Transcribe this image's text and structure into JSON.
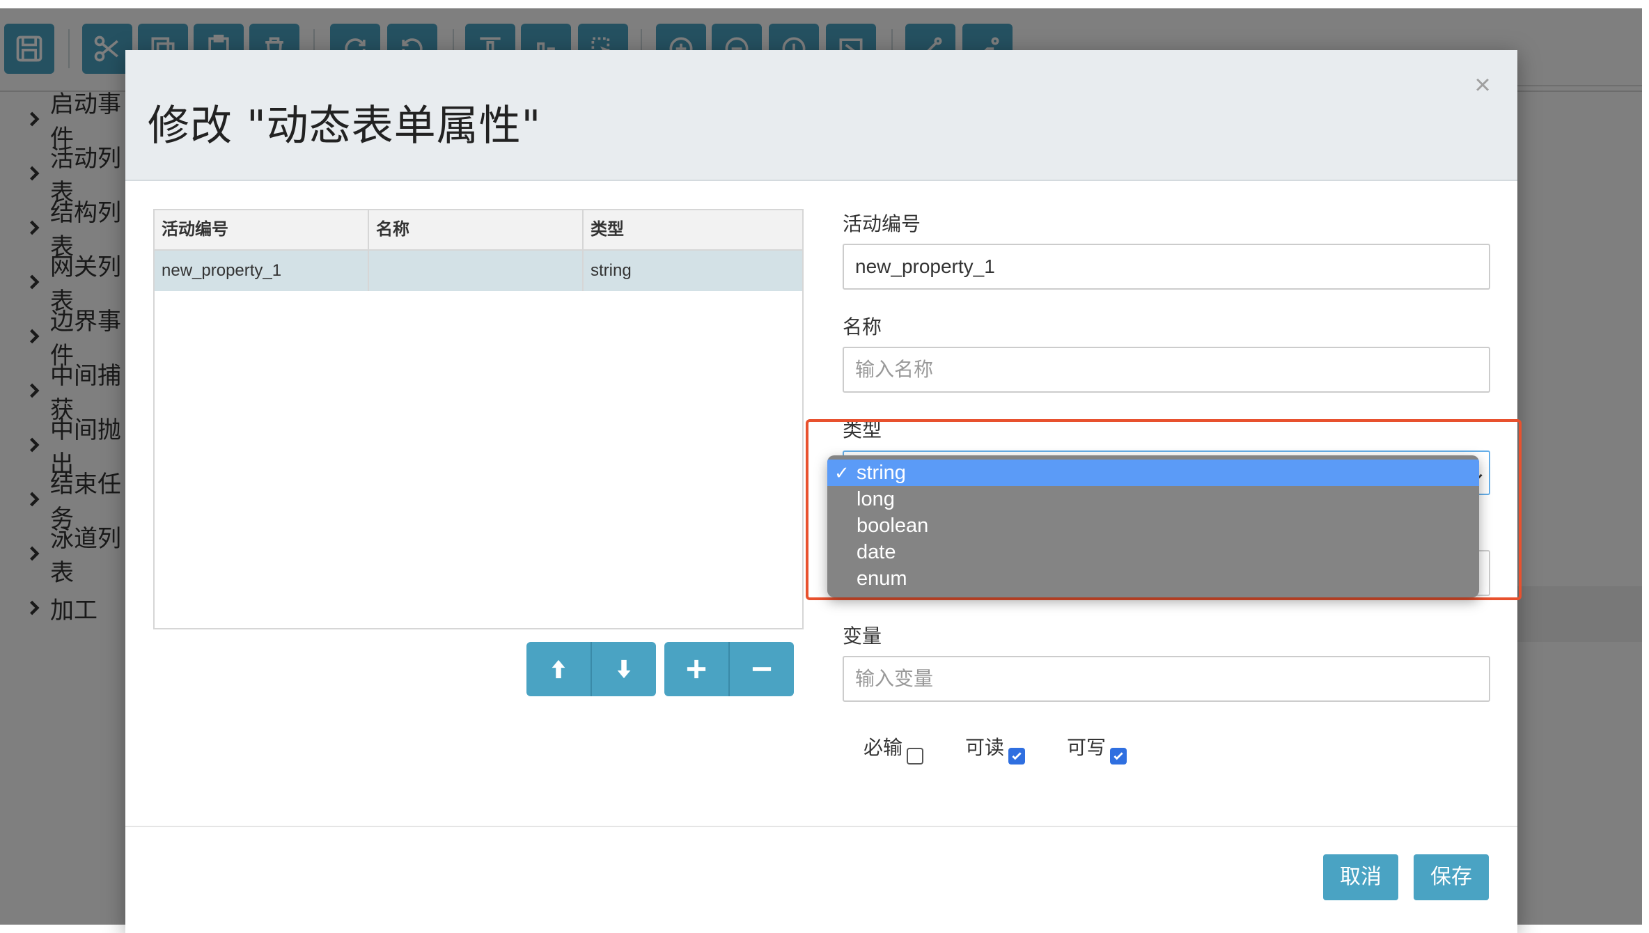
{
  "sidebar": {
    "items": [
      {
        "label": "启动事件"
      },
      {
        "label": "活动列表"
      },
      {
        "label": "结构列表"
      },
      {
        "label": "网关列表"
      },
      {
        "label": "边界事件"
      },
      {
        "label": "中间捕获"
      },
      {
        "label": "中间抛出"
      },
      {
        "label": "结束任务"
      },
      {
        "label": "泳道列表"
      },
      {
        "label": "加工"
      }
    ]
  },
  "toolbar": {
    "icons": [
      "save-icon",
      "cut-icon",
      "copy-icon",
      "paste-icon",
      "delete-icon",
      "redo-icon",
      "undo-icon",
      "align-top-icon",
      "align-bottom-icon",
      "select-icon",
      "zoom-in-icon",
      "zoom-out-icon",
      "zoom-reset-icon",
      "fit-icon",
      "connector-icon",
      "connector-alt-icon"
    ]
  },
  "dialog": {
    "title": "修改 \"动态表单属性\"",
    "close": "×",
    "table": {
      "headers": [
        "活动编号",
        "名称",
        "类型"
      ],
      "rows": [
        {
          "id": "new_property_1",
          "name": "",
          "type": "string"
        }
      ]
    },
    "form": {
      "id_label": "活动编号",
      "id_value": "new_property_1",
      "name_label": "名称",
      "name_placeholder": "输入名称",
      "type_label": "类型",
      "type_options": [
        "string",
        "long",
        "boolean",
        "date",
        "enum"
      ],
      "type_selected": "string",
      "variable_label": "变量",
      "variable_placeholder": "输入变量",
      "required_label": "必输",
      "readable_label": "可读",
      "writable_label": "可写"
    },
    "checks": {
      "required": false,
      "readable": true,
      "writable": true
    },
    "cancel_label": "取消",
    "save_label": "保存"
  },
  "colors": {
    "accent": "#4aa3c3",
    "highlight_border": "#e8512e",
    "dropdown_bg": "#848484",
    "dropdown_selected": "#5b9bf7"
  }
}
